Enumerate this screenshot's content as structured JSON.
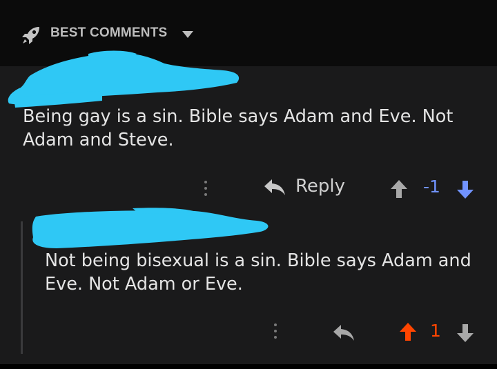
{
  "header": {
    "sort_label": "BEST COMMENTS",
    "icon": "rocket-icon",
    "caret_icon": "caret-down-icon"
  },
  "comments": [
    {
      "author": "[redacted]",
      "body": "Being gay is a sin. Bible says Adam and Eve. Not Adam and Steve.",
      "reply_label": "Reply",
      "score": "-1",
      "vote_state": "downvoted",
      "score_color": "#7193ff"
    },
    {
      "author": "[redacted]",
      "body": "Not being bisexual is a sin. Bible says Adam and Eve. Not Adam or Eve.",
      "score": "1",
      "vote_state": "upvoted",
      "score_color": "#ff4500"
    }
  ],
  "colors": {
    "header_bg": "#0b0b0b",
    "thread_bg": "#1a1a1b",
    "redaction": "#2fc8f5",
    "upvote_orange": "#ff4500",
    "downvote_blue": "#7193ff",
    "neutral_icon": "#a8a8a8"
  }
}
